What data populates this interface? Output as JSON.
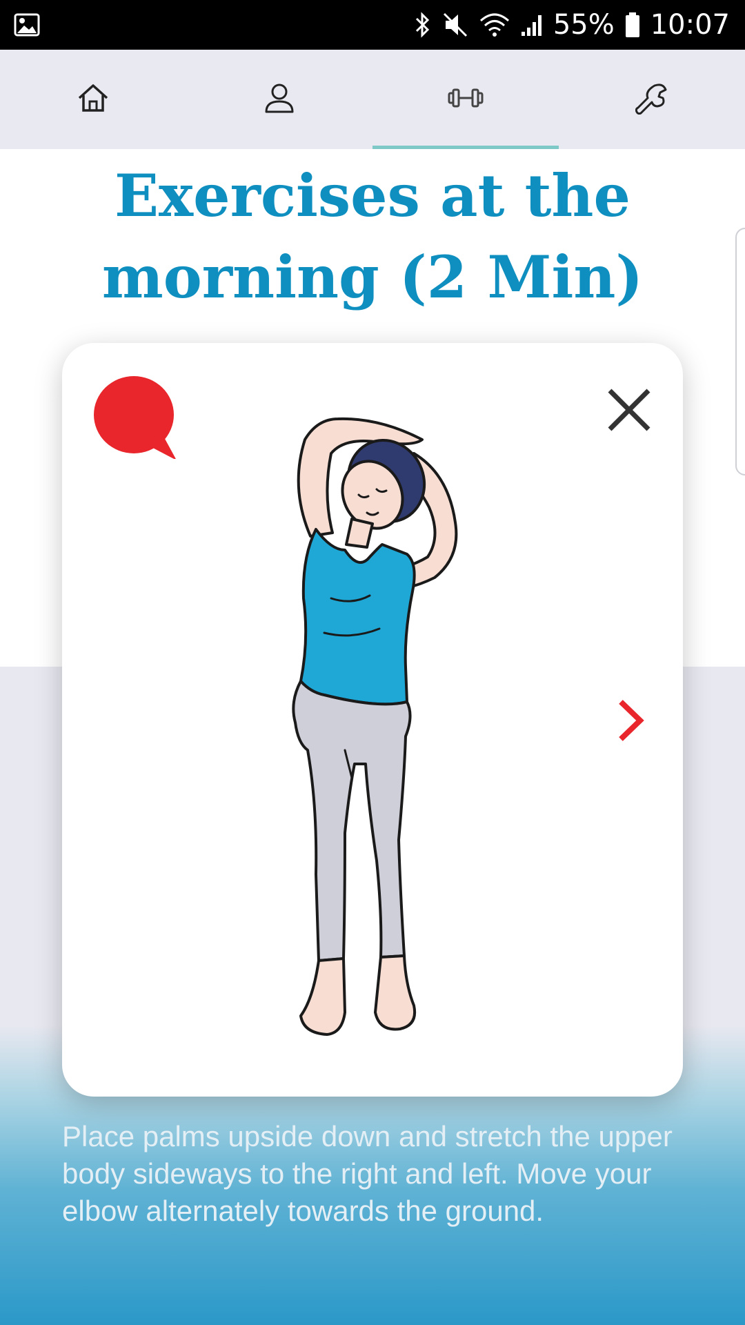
{
  "status_bar": {
    "battery": "55%",
    "time": "10:07",
    "icons": [
      "gallery-icon",
      "bluetooth-icon",
      "mute-icon",
      "wifi-icon",
      "signal-icon",
      "battery-icon"
    ]
  },
  "tabs": [
    {
      "name": "home",
      "icon": "home-icon",
      "active": false
    },
    {
      "name": "profile",
      "icon": "user-icon",
      "active": false
    },
    {
      "name": "exercises",
      "icon": "dumbbell-icon",
      "active": true
    },
    {
      "name": "settings",
      "icon": "wrench-icon",
      "active": false
    }
  ],
  "page": {
    "title": "Exercises at the morning (2 Min)"
  },
  "card": {
    "speech_icon": "speech-bubble-icon",
    "close_icon": "close-icon",
    "next_icon": "chevron-right-icon",
    "description": "Place palms upside down and stretch the upper body sideways to the right and left. Move your elbow alternately towards the ground."
  },
  "colors": {
    "title": "#0f8fc0",
    "accent_red": "#e8262b",
    "tab_indicator": "#7ec8c8",
    "shirt": "#1fa8d6",
    "pants": "#cfcfd9"
  }
}
